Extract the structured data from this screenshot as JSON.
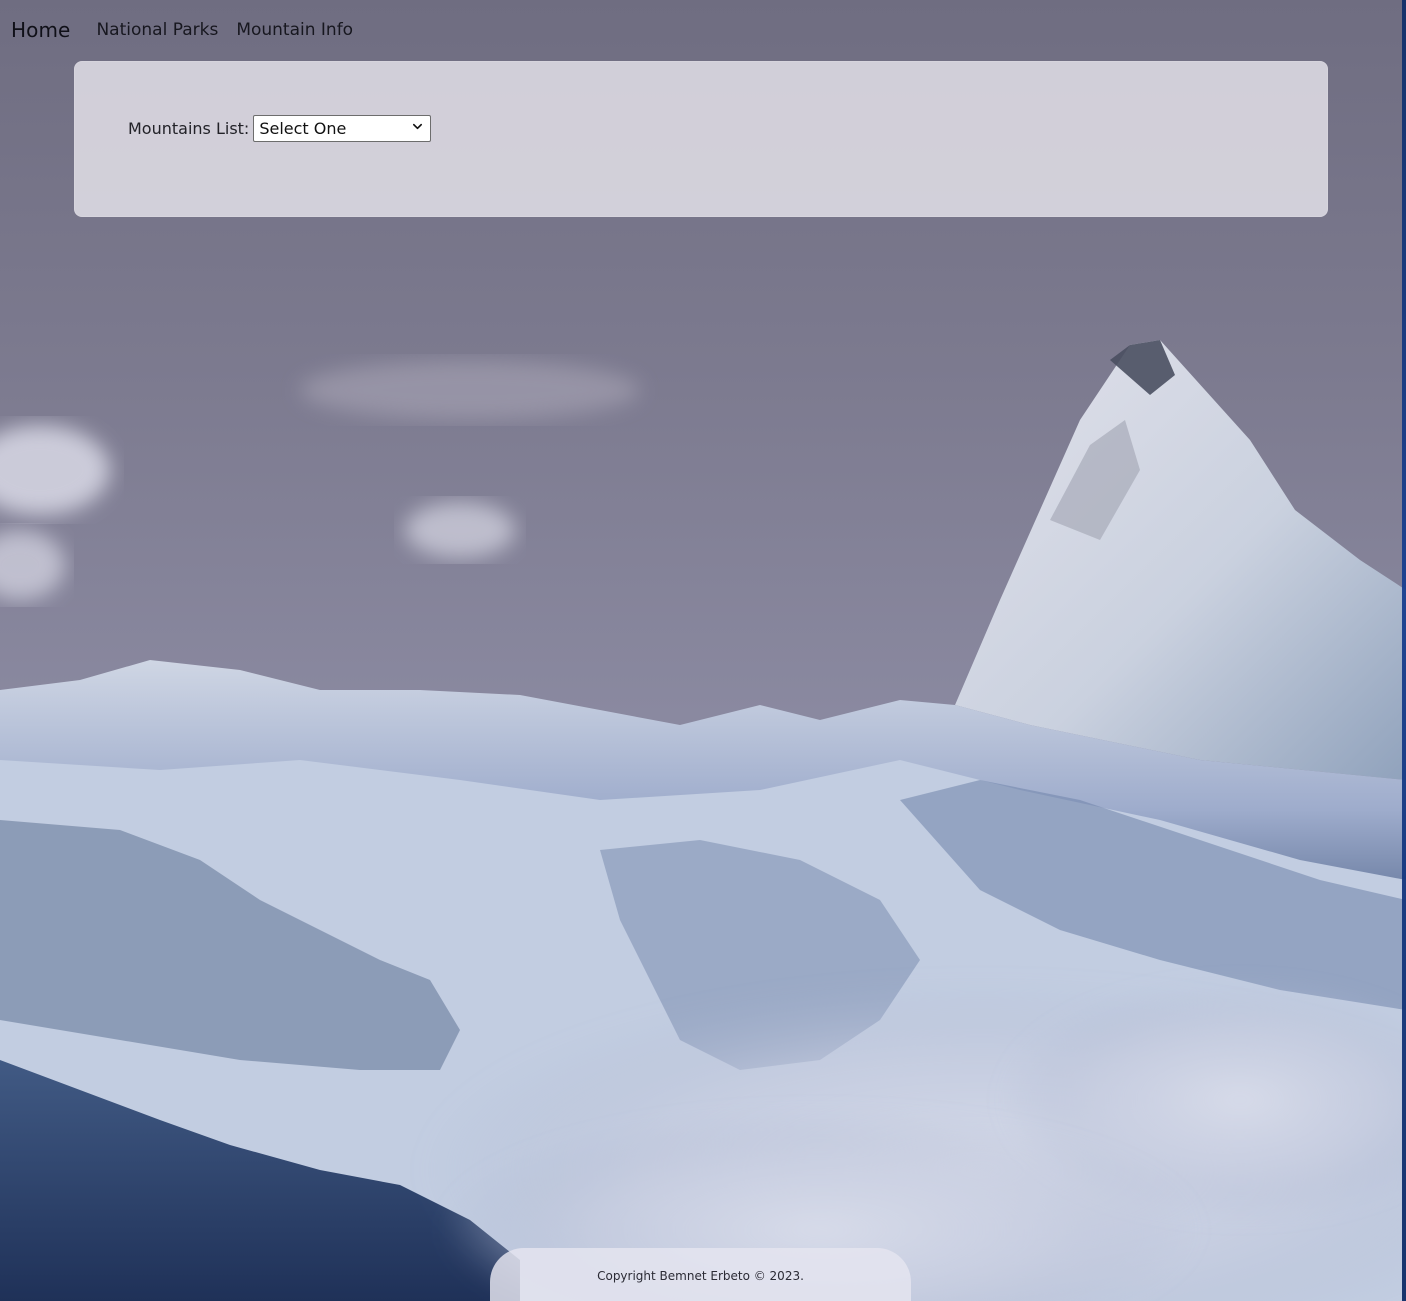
{
  "nav": {
    "brand": "Home",
    "links": [
      "National Parks",
      "Mountain Info"
    ]
  },
  "filter": {
    "label": "Mountains List:",
    "selected_option": "Select One"
  },
  "footer": {
    "text": "Copyright Bemnet Erbeto © 2023."
  },
  "colors": {
    "overlay_panel": "#e6e4eb",
    "text": "#1f1f27",
    "sky_top": "#6d6a80",
    "sky_bottom": "#8f8ca5",
    "snow": "#dfe5ef",
    "rock": "#5d6b83",
    "cloud": "#cfd3e2",
    "edge_blue": "#1a3f8f"
  },
  "icons": {
    "select_chevron": "chevron-down-icon"
  }
}
